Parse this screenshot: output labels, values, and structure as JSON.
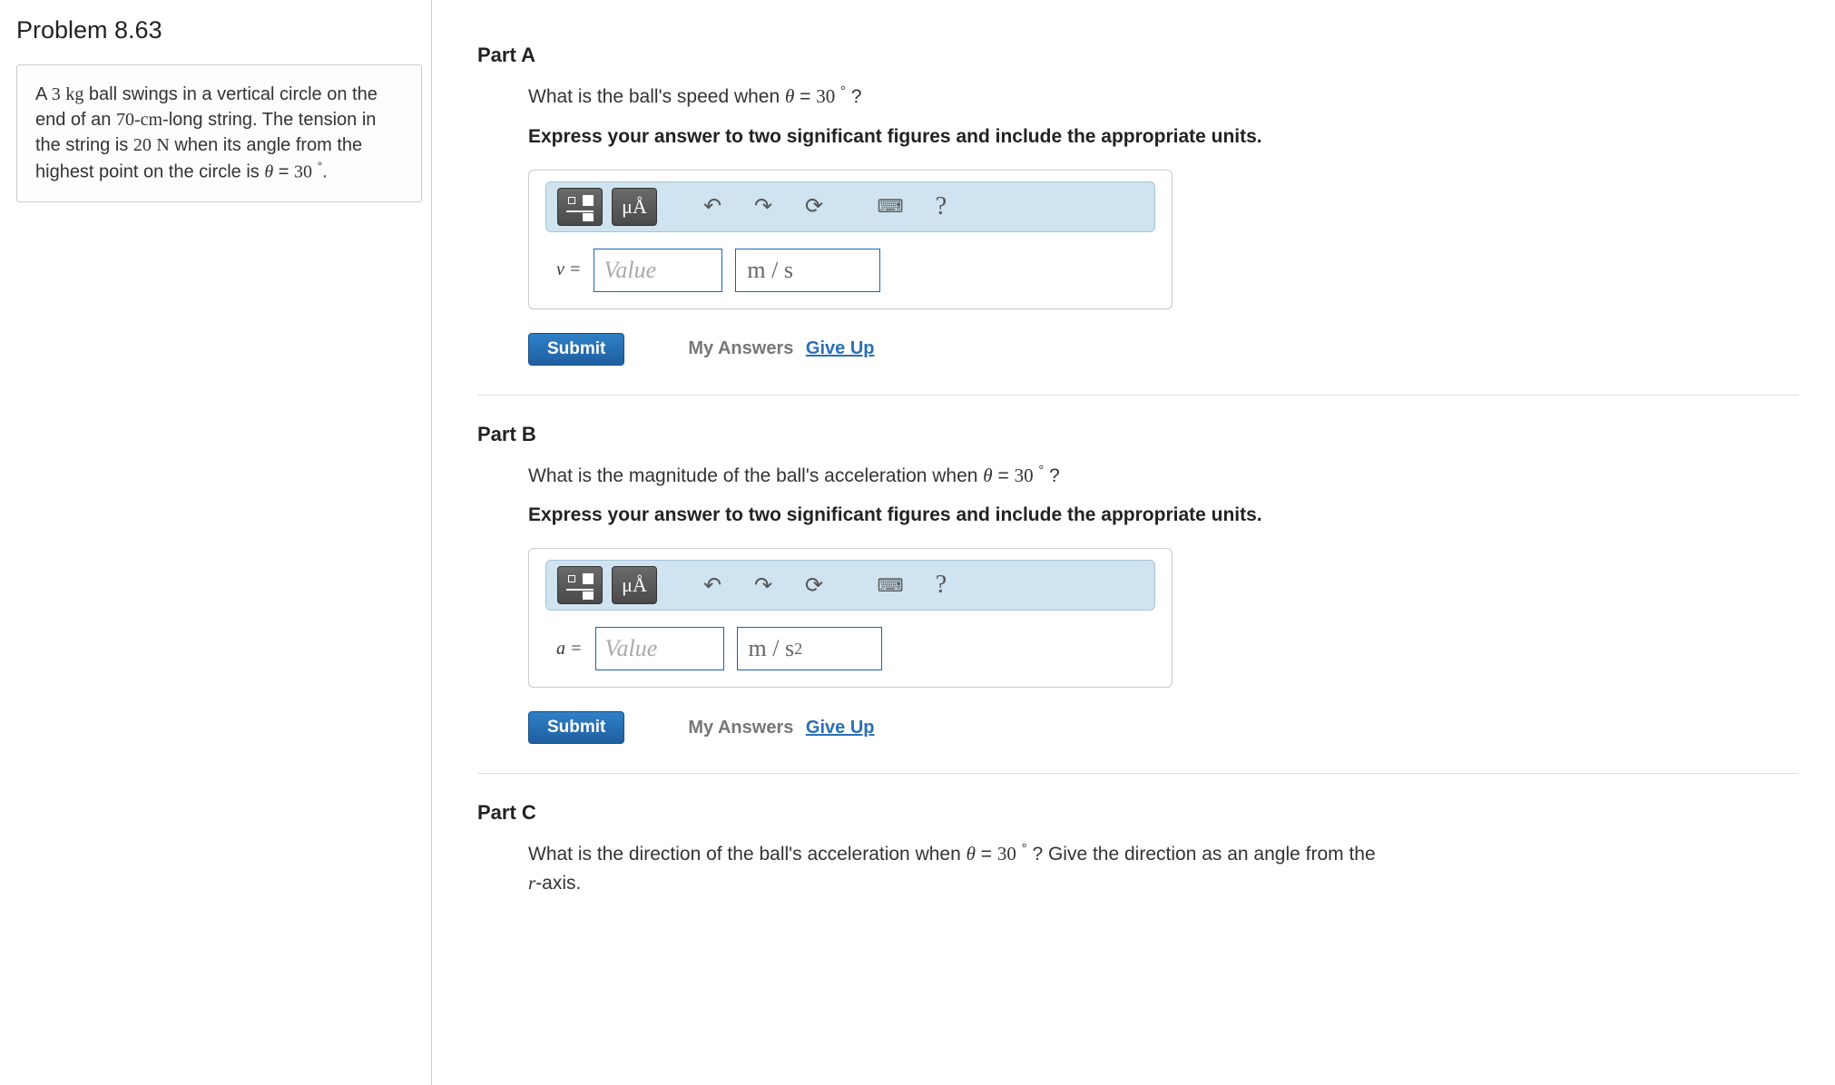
{
  "problem": {
    "title": "Problem 8.63",
    "statement_plain": "A 3 kg ball swings in a vertical circle on the end of an 70-cm-long string. The tension in the string is 20 N when its angle from the highest point on the circle is θ = 30 ° .",
    "mass_value": "3",
    "mass_unit": "kg",
    "length_text": "70-cm",
    "tension_value": "20",
    "tension_unit": "N",
    "theta_value": "30",
    "theta_deg": "°"
  },
  "partA": {
    "heading": "Part A",
    "question_prefix": "What is the ball's speed when ",
    "theta_expr": "θ = 30 ° ",
    "qmark": "?",
    "instruction": "Express your answer to two significant figures and include the appropriate units.",
    "var_label": "v =",
    "value_placeholder": "Value",
    "units": "m / s",
    "submit": "Submit",
    "my_answers": "My Answers",
    "give_up": "Give Up"
  },
  "partB": {
    "heading": "Part B",
    "question_prefix": "What is the magnitude of the ball's acceleration when ",
    "theta_expr": "θ = 30 ° ",
    "qmark": "?",
    "instruction": "Express your answer to two significant figures and include the appropriate units.",
    "var_label": "a =",
    "value_placeholder": "Value",
    "units_html": "m / s²",
    "submit": "Submit",
    "my_answers": "My Answers",
    "give_up": "Give Up"
  },
  "partC": {
    "heading": "Part C",
    "question_prefix": "What is the direction of the ball's acceleration when ",
    "theta_expr": "θ = 30 ° ",
    "qmark_tail": "? Give the direction as an angle from the ",
    "raxis": "r",
    "raxis_tail": "-axis."
  },
  "toolbar": {
    "templates_label": "templates",
    "symbols_label": "μÅ",
    "undo": "↶",
    "redo": "↷",
    "reset": "⟳",
    "keyboard": "⌨",
    "help": "?"
  }
}
